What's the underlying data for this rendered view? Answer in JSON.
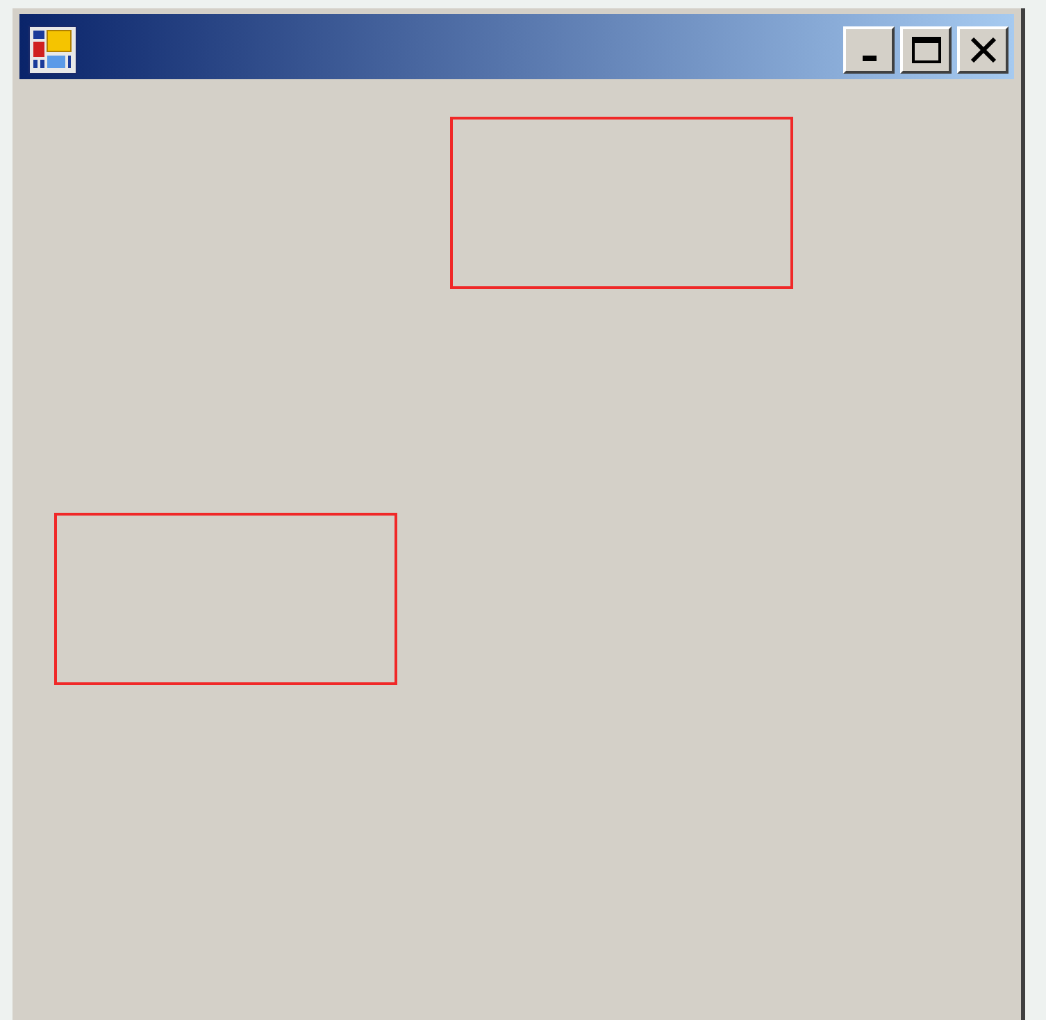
{
  "window": {
    "controls": [
      {
        "kind": "minimize"
      },
      {
        "kind": "maximize"
      },
      {
        "kind": "close"
      }
    ]
  },
  "canvas": {
    "shapes": [
      {
        "kind": "rectangle"
      },
      {
        "kind": "rectangle"
      }
    ]
  }
}
